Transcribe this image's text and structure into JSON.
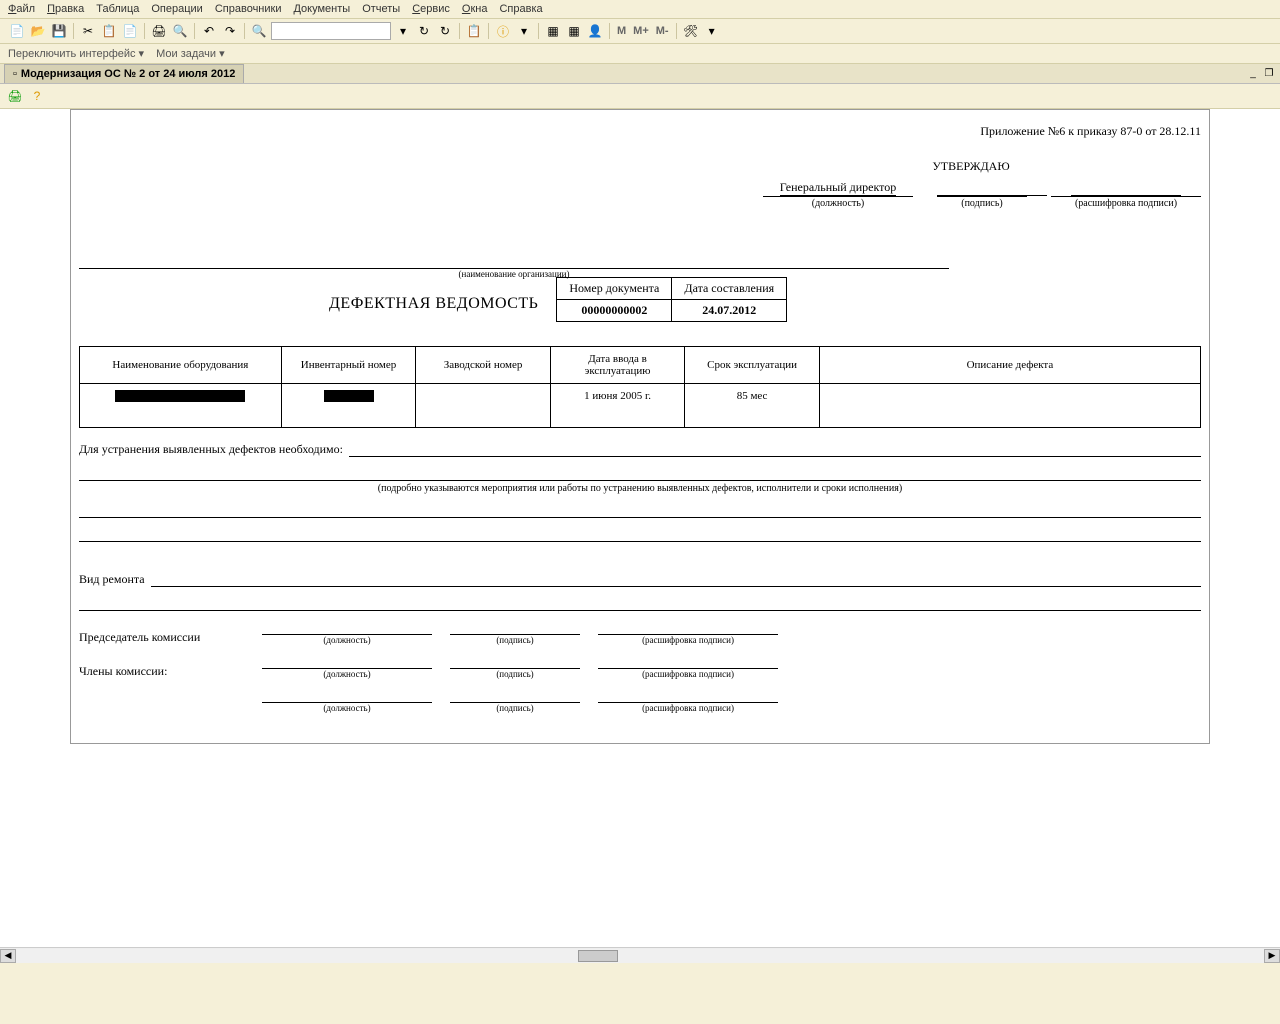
{
  "menu": {
    "file": "Файл",
    "edit": "Правка",
    "table": "Таблица",
    "operations": "Операции",
    "dictionaries": "Справочники",
    "documents": "Документы",
    "reports": "Отчеты",
    "service": "Сервис",
    "windows": "Окна",
    "help": "Справка"
  },
  "toolbar": {
    "m": "M",
    "mplus": "M+",
    "mminus": "M-"
  },
  "linkbar": {
    "switch_interface": "Переключить интерфейс ▾",
    "my_tasks": "Мои задачи ▾"
  },
  "tab": {
    "title": "Модернизация ОС № 2 от 24 июля 2012"
  },
  "doc": {
    "annex": "Приложение №6 к приказу 87-0 от 28.12.11",
    "approve": "УТВЕРЖДАЮ",
    "gendir": "Генеральный директор",
    "position": "(должность)",
    "signature": "(подпись)",
    "decipher": "(расшифровка подписи)",
    "org_caption": "(наименование организации)",
    "title": "ДЕФЕКТНАЯ ВЕДОМОСТЬ",
    "num_label": "Номер документа",
    "date_label": "Дата составления",
    "num_value": "00000000002",
    "date_value": "24.07.2012",
    "fix_label": "Для устранения выявленных дефектов необходимо:",
    "fix_note": "(подробно указываются мероприятия или работы по устранению выявленных дефектов, исполнители и сроки исполнения)",
    "repair_label": "Вид ремонта",
    "chairman": "Председатель комиссии",
    "members": "Члены комиссии:"
  },
  "equip": {
    "h_name": "Наименование оборудования",
    "h_inv": "Инвентарный номер",
    "h_factory": "Заводской номер",
    "h_commiss": "Дата ввода в эксплуатацию",
    "h_term": "Срок эксплуатации",
    "h_defect": "Описание дефекта",
    "r_commiss": "1 июня 2005 г.",
    "r_term": "85 мес"
  }
}
